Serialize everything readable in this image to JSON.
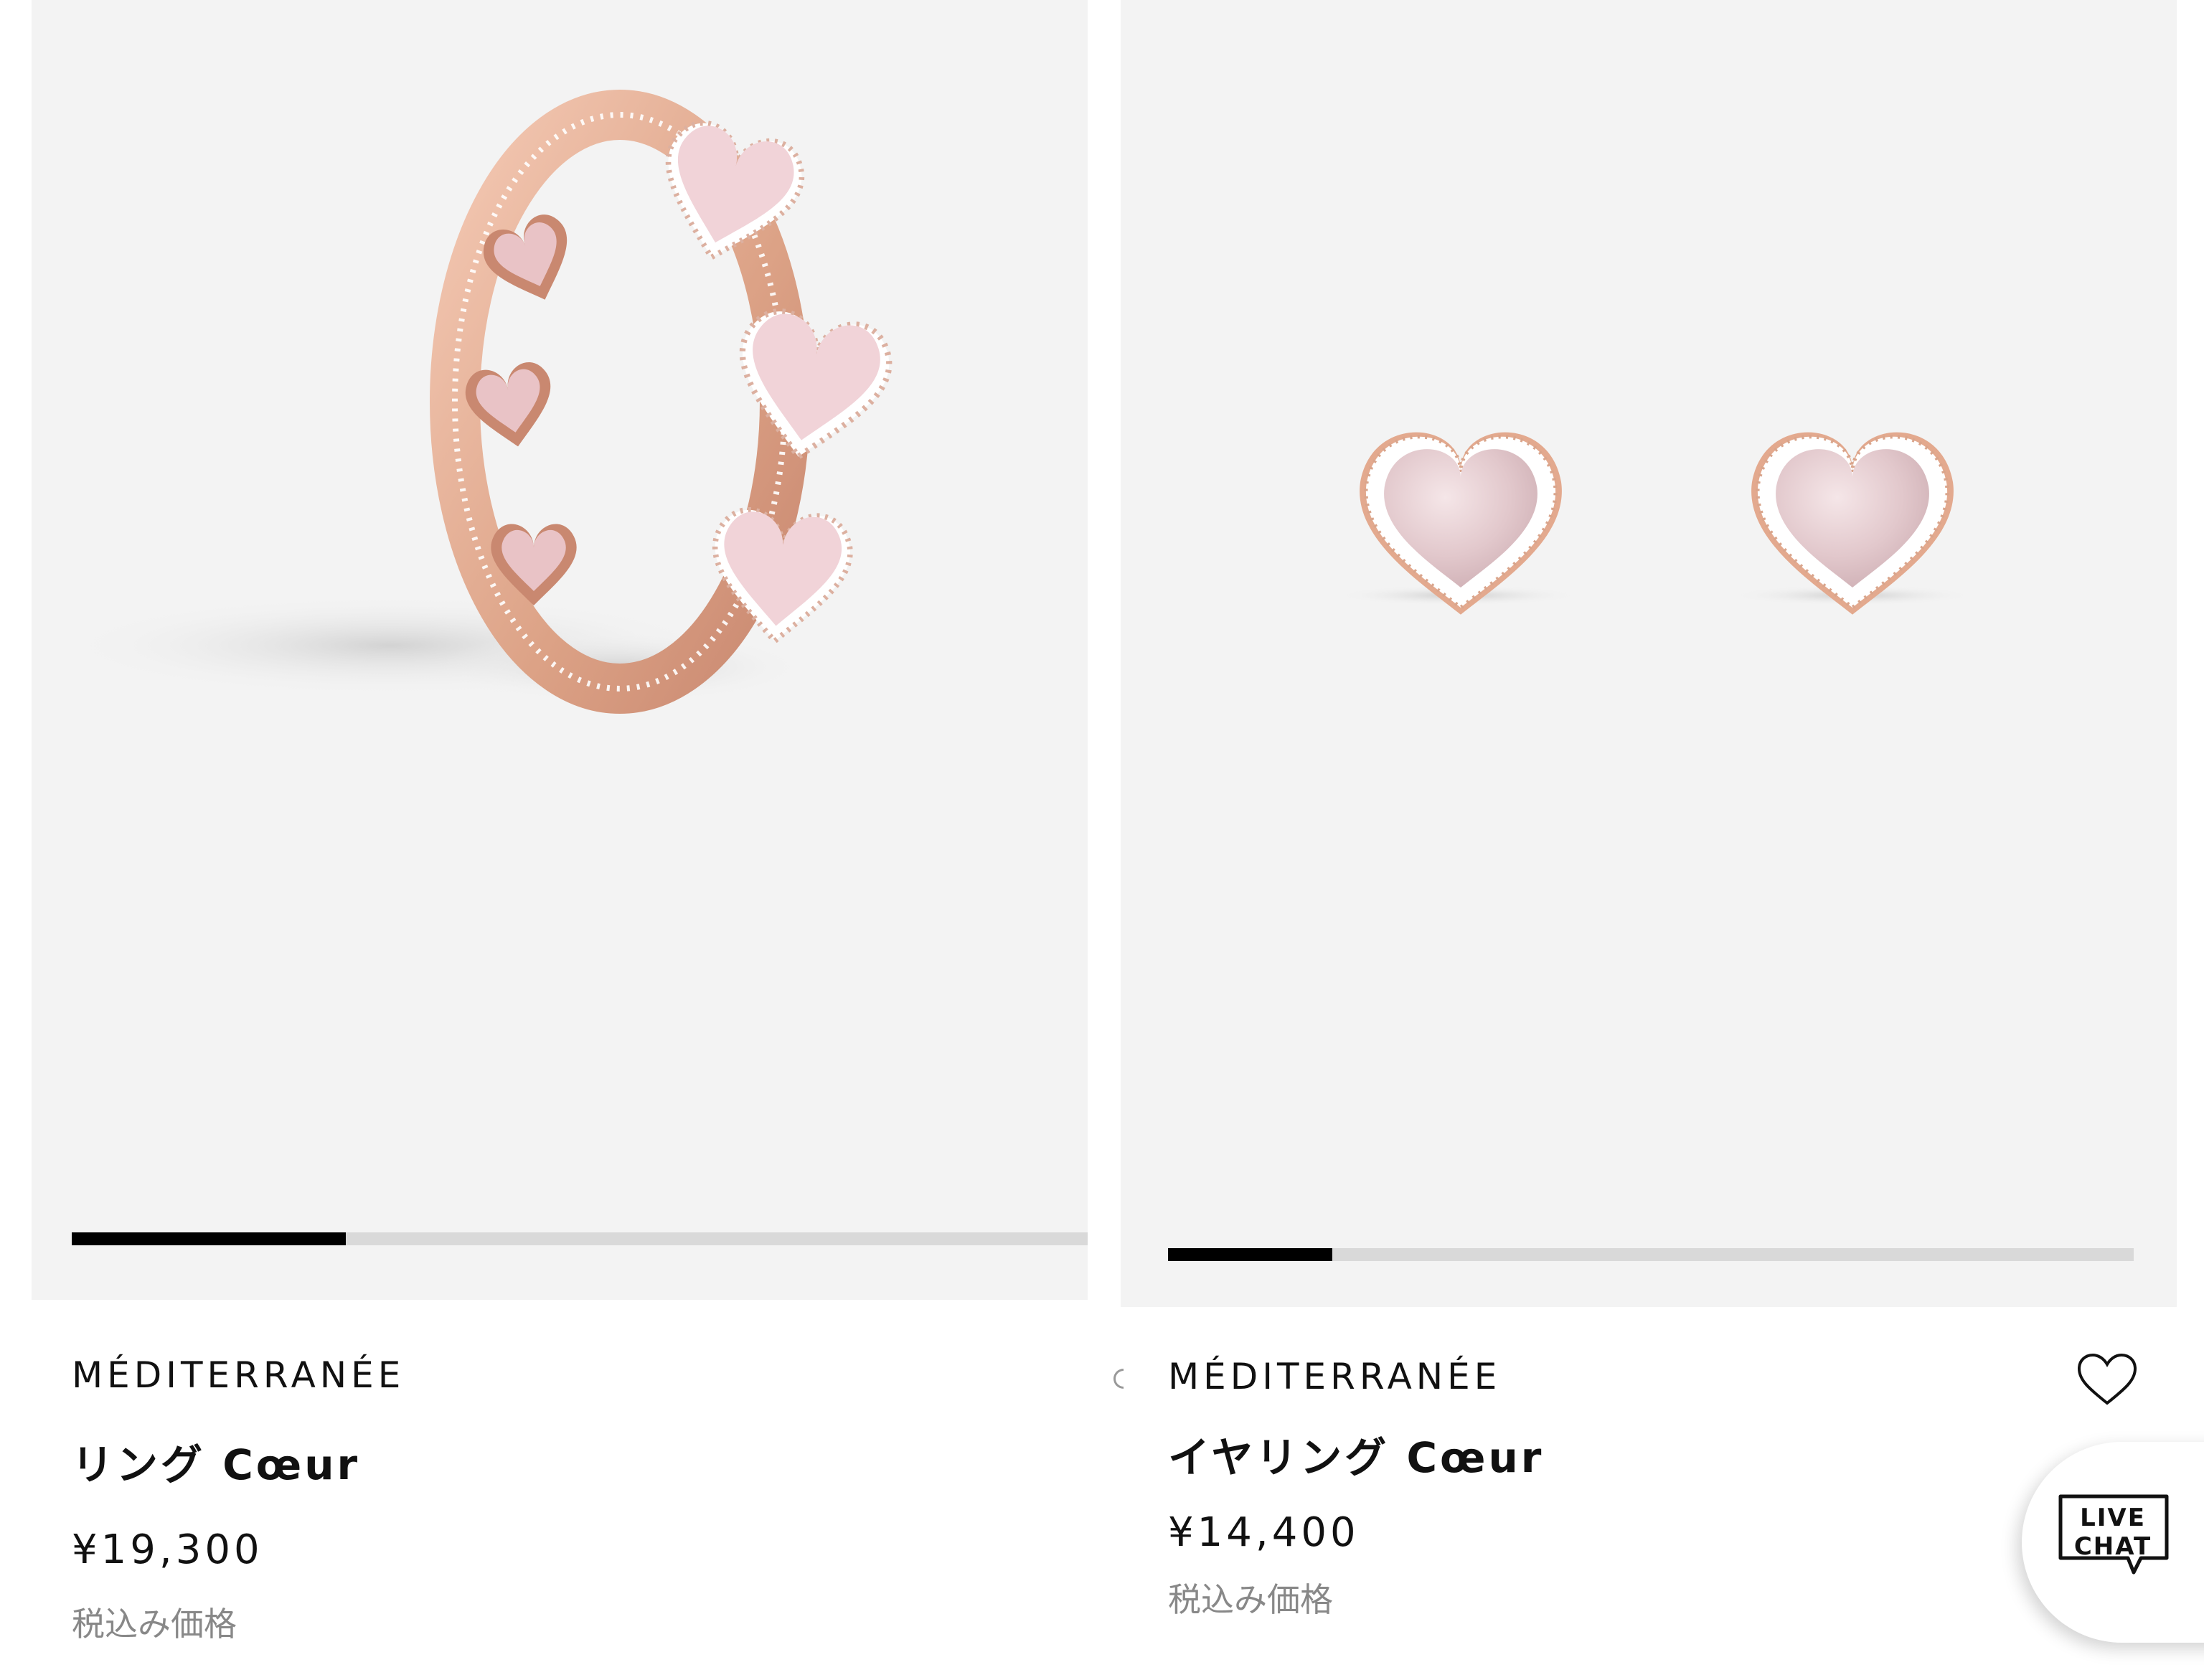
{
  "products": [
    {
      "brand": "MÉDITERRANÉE",
      "name": "リング Cœur",
      "price": "¥19,300",
      "tax_note": "税込み価格",
      "gallery_progress": 0.27
    },
    {
      "brand": "MÉDITERRANÉE",
      "name": "イヤリング Cœur",
      "price": "¥14,400",
      "tax_note": "税込み価格",
      "gallery_progress": 0.17
    }
  ],
  "live_chat": {
    "label": "LIVE\nCHAT"
  },
  "icons": {
    "favorite": "heart-outline-icon",
    "chat": "chat-bubble-icon"
  },
  "colors": {
    "image_bg": "#f3f3f3",
    "rose_gold": "#e3a98e",
    "pink_stone": "#f1d3d8",
    "progress_fill": "#000000",
    "progress_track": "#d9d9d9",
    "muted_text": "#888888"
  }
}
